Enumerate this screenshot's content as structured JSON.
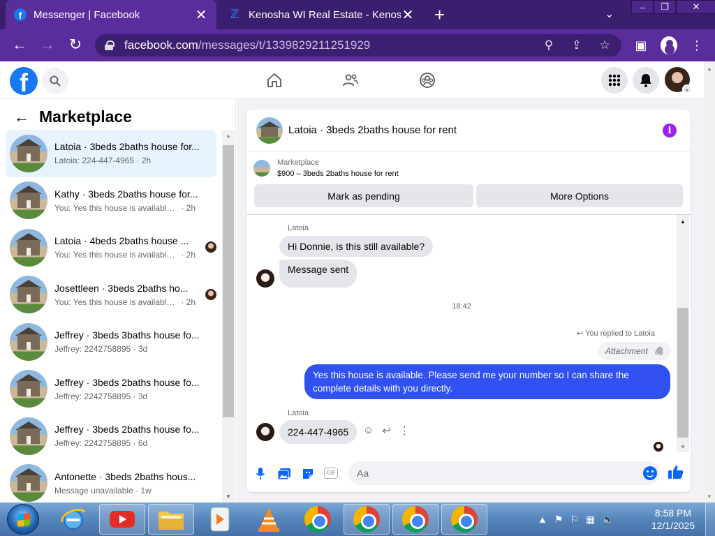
{
  "browser": {
    "tabs": [
      {
        "title": "Messenger | Facebook",
        "active": true
      },
      {
        "title": "Kenosha WI Real Estate - Kenosha",
        "active": false
      }
    ],
    "tab_close_glyph": "✕",
    "new_tab_glyph": "+",
    "url_host": "facebook.com",
    "url_path": "/messages/t/1339829211251929",
    "window_controls": [
      "–",
      "❐",
      "✕"
    ]
  },
  "marketplace": {
    "title": "Marketplace",
    "conversations": [
      {
        "name": "Latoia · 3beds 2baths house for...",
        "preview": "Latoia: 224-447-4965",
        "time": "2h",
        "selected": true
      },
      {
        "name": "Kathy · 3beds 2baths house for...",
        "preview": "You: Yes this house is available. Pl...",
        "time": "2h"
      },
      {
        "name": "Latoia · 4beds 2baths house ...",
        "preview": "You: Yes this house is available. ...",
        "time": "2h"
      },
      {
        "name": "Josettleen · 3beds 2baths ho...",
        "preview": "You: Yes this house is available. ...",
        "time": "2h"
      },
      {
        "name": "Jeffrey · 3beds 3baths house fo...",
        "preview": "Jeffrey: 2242758895",
        "time": "3d"
      },
      {
        "name": "Jeffrey · 3beds 2baths house fo...",
        "preview": "Jeffrey: 2242758895",
        "time": "3d"
      },
      {
        "name": "Jeffrey · 3beds 2baths house fo...",
        "preview": "Jeffrey: 2242758895",
        "time": "6d"
      },
      {
        "name": "Antonette · 3beds 2baths hous...",
        "preview": "Message unavailable",
        "time": "1w"
      }
    ]
  },
  "chat": {
    "title": "Latoia · 3beds 2baths house for rent",
    "listing_label": "Marketplace",
    "listing_price": "$900 – 3beds 2baths house for rent",
    "mark_pending": "Mark as pending",
    "more_options": "More Options",
    "messages": {
      "sender1": "Latoia",
      "msg1": "Hi Donnie, is this still available?",
      "msg2": "Message sent",
      "time": "18:42",
      "reply_note": "You replied to Latoia",
      "attachment": "Attachment",
      "reply": "Yes this house is available. Please send me your number so I can share the complete details with you directly.",
      "sender2": "Latoia",
      "msg3": "224-447-4965"
    },
    "composer_placeholder": "Aa"
  },
  "taskbar": {
    "time": "8:58 PM",
    "date": "12/1/2025"
  },
  "colors": {
    "chrome_frame": "#3a1f6e",
    "chrome_toolbar": "#5a2d9c",
    "fb_blue": "#1877f2",
    "outgoing_bubble": "#3050f0",
    "info_purple": "#a020f0"
  }
}
